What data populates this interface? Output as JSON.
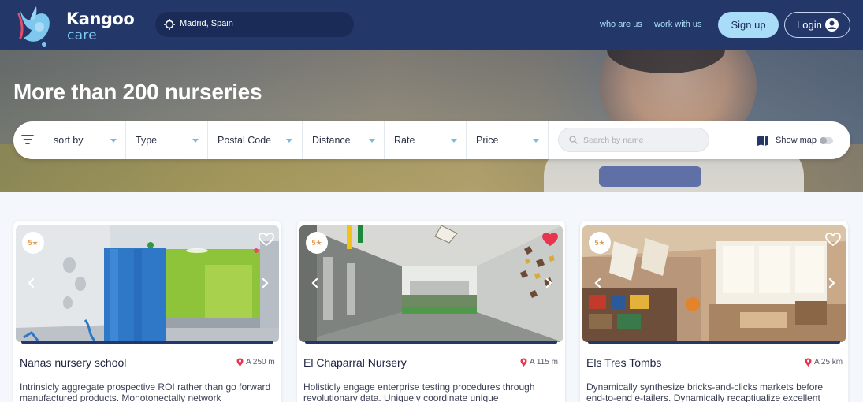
{
  "header": {
    "brand_line1": "Kangoo",
    "brand_line2": "care",
    "location": "Madrid, Spain",
    "nav": [
      "who are us",
      "work with us"
    ],
    "signup_label": "Sign up",
    "login_label": "Login",
    "icons": {
      "logo": "kangaroo-logo",
      "location": "crosshair-icon",
      "login": "user-circle-icon"
    },
    "colors": {
      "header_bg": "#233769",
      "accent": "#a9dcf6"
    }
  },
  "hero": {
    "title": "More than 200 nurseries"
  },
  "filters": {
    "items": [
      "sort by",
      "Type",
      "Postal Code",
      "Distance",
      "Rate",
      "Price"
    ],
    "search_placeholder": "Search by name",
    "show_map_label": "Show map",
    "show_map_on": false
  },
  "cards": [
    {
      "rating": "5★",
      "name": "Nanas nursery school",
      "distance": "A 250 m",
      "description": "Intrinsicly aggregate prospective ROI rather than go forward manufactured products. Monotonectally network",
      "favorite": false,
      "active_dot": 0
    },
    {
      "rating": "5★",
      "name": "El Chaparral Nursery",
      "distance": "A 115 m",
      "description": "Holisticly engage enterprise testing procedures through revolutionary data. Uniquely coordinate unique infomediaries",
      "favorite": true,
      "active_dot": 0
    },
    {
      "rating": "5★",
      "name": "Els Tres Tombs",
      "distance": "A 25 km",
      "description": "Dynamically synthesize bricks-and-clicks markets before end-to-end e-tailers. Dynamically recaptiualize excellent",
      "favorite": false,
      "active_dot": 0
    }
  ]
}
